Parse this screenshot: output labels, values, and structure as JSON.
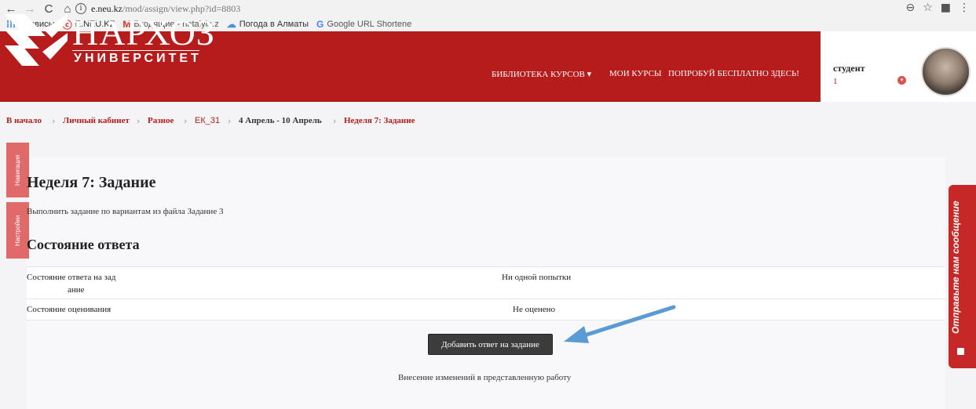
{
  "browser": {
    "back_icon": "←",
    "forward_icon": "→",
    "reload_icon": "C",
    "home_icon": "⌂",
    "url_domain": "e.neu.kz",
    "url_path": "/mod/assign/view.php?id=8803",
    "zoom_icon": "⊖",
    "star_icon": "☆",
    "menu_icon": "⋮"
  },
  "bookmarks": [
    {
      "icon": "⁞⁞⁞",
      "label": "Сервисы"
    },
    {
      "icon": "ⓒ",
      "label": "E.NEU.KZ"
    },
    {
      "icon": "M",
      "label": "Входящие - natalyia.z"
    },
    {
      "icon": "☁",
      "label": "Погода в Алматы"
    },
    {
      "icon": "G",
      "label": "Google URL Shortene"
    }
  ],
  "header": {
    "logo_title": "НАРХОЗ",
    "logo_subtitle": "УНИВЕРСИТЕТ",
    "menu": [
      "БИБЛИОТЕКА КУРСОВ ▾",
      "МОИ КУРСЫ",
      "ПОПРОБУЙ БЕСПЛАТНО ЗДЕСЬ!"
    ],
    "user_name": "студент",
    "user_number": "1",
    "caret_icon": "▾"
  },
  "breadcrumb": [
    "В начало",
    "Личный кабинет",
    "Разное",
    "ЕК_31",
    "4 Апрель - 10 Апрель",
    "Неделя 7: Задание"
  ],
  "breadcrumb_sep": "›",
  "side_tabs": [
    "Навигация",
    "Настройки"
  ],
  "page": {
    "title": "Неделя 7: Задание",
    "description": "Выполнить задание по вариантам из файла Задание 3",
    "section_title": "Состояние ответа"
  },
  "status_table": [
    {
      "label_line1": "Состояние ответа на зад",
      "label_line2": "ание",
      "value": "Ни одной попытки"
    },
    {
      "label": "Состояние оценивания",
      "value": "Не оценено"
    }
  ],
  "actions": {
    "submit_label": "Добавить ответ на задание",
    "edit_note": "Внесение изменений в представленную работу"
  },
  "feedback": {
    "label": "Отправьте нам сообщение"
  },
  "colors": {
    "brand": "#b71c1c",
    "side_tab": "#e06a6a",
    "arrow": "#5b9bd5"
  }
}
